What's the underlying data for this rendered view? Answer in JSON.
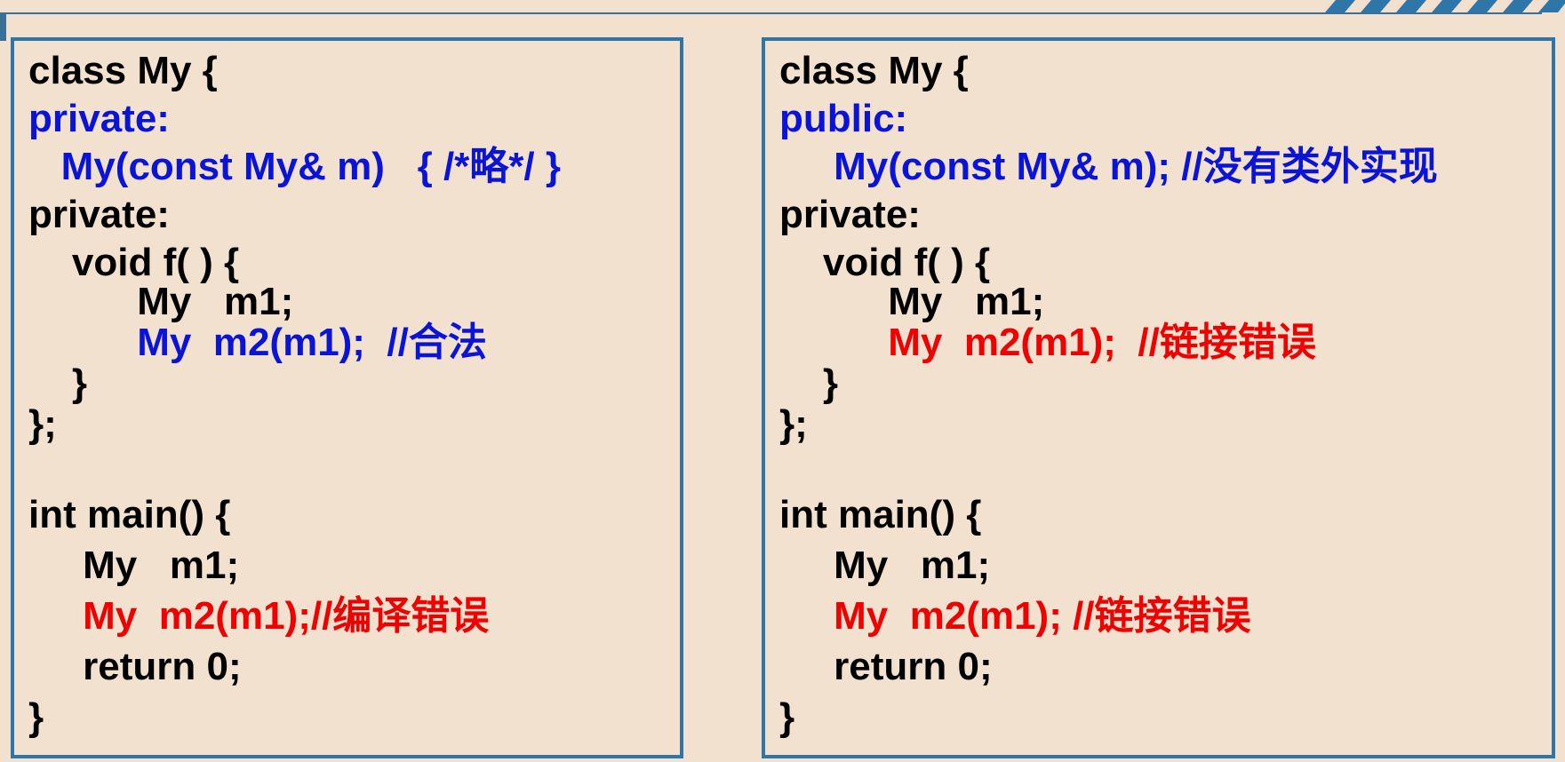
{
  "colors": {
    "frame": "#2e75a8",
    "background": "#f2e1cf",
    "blue": "#0a14d8",
    "red": "#f00000",
    "black": "#000000"
  },
  "left_panel": {
    "lines": [
      "class My {",
      "private:",
      "   My(const My& m)   { /*略*/ }",
      "private:",
      "    void f( ) {",
      "          My   m1;",
      "          My  m2(m1);  //合法",
      "    }",
      "};",
      "int main() {",
      "     My   m1;",
      "     My  m2(m1);//编译错误",
      "     return 0;",
      "}"
    ]
  },
  "right_panel": {
    "lines": [
      "class My {",
      "public:",
      "     My(const My& m); //没有类外实现",
      "private:",
      "    void f( ) {",
      "          My   m1;",
      "          My  m2(m1);  //链接错误",
      "    }",
      "};",
      "int main() {",
      "     My   m1;",
      "     My  m2(m1); //链接错误",
      "     return 0;",
      "}"
    ]
  }
}
